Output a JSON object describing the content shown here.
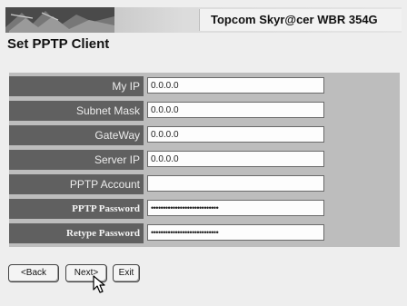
{
  "header": {
    "brand": "Topcom Skyr@cer WBR 354G"
  },
  "page": {
    "title": "Set PPTP Client"
  },
  "form": {
    "rows": [
      {
        "label": "My IP",
        "value": "0.0.0.0"
      },
      {
        "label": "Subnet Mask",
        "value": "0.0.0.0"
      },
      {
        "label": "GateWay",
        "value": "0.0.0.0"
      },
      {
        "label": "Server IP",
        "value": "0.0.0.0"
      },
      {
        "label": "PPTP Account",
        "value": ""
      },
      {
        "label": "PPTP Password",
        "value": "••••••••••••••••••••••••••••"
      },
      {
        "label": "Retype Password",
        "value": "••••••••••••••••••••••••••••"
      }
    ]
  },
  "buttons": {
    "back": "<Back",
    "next": "Next>",
    "exit": "Exit"
  },
  "icons": {
    "banner": "banner-graphic-icon",
    "cursor": "mouse-pointer-icon"
  }
}
